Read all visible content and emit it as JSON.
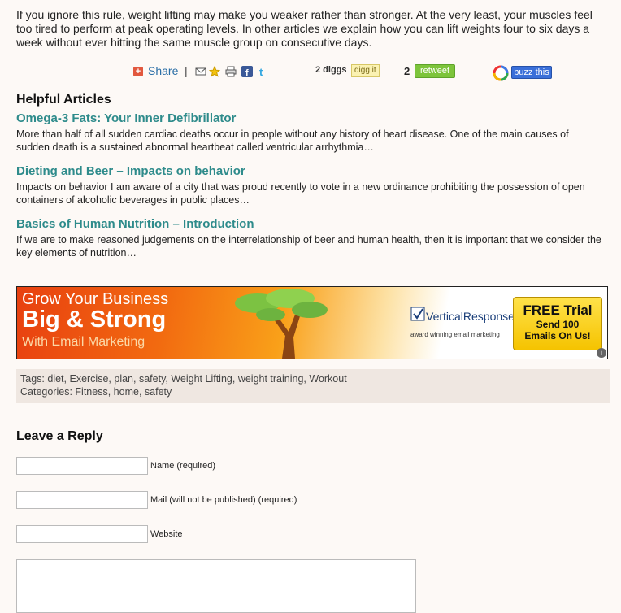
{
  "intro_text": "If you ignore this rule, weight lifting may make you weaker rather than stronger. At the very least, your muscles feel too tired to perform at peak operating levels. In other articles we explain how you can lift weights four to six days a week without ever hitting the same muscle group on consecutive days.",
  "share": {
    "share_label": "Share",
    "separator": "|",
    "icons": [
      "plus-icon",
      "mail-icon",
      "star-icon",
      "print-icon",
      "facebook-icon",
      "twitter-icon"
    ],
    "diggs_count": "2 diggs",
    "digg_button": "digg it",
    "retweet_count": "2",
    "retweet_button": "retweet",
    "buzz_button": "buzz this"
  },
  "helpful": {
    "heading": "Helpful Articles",
    "articles": [
      {
        "title": "Omega-3 Fats: Your Inner Defibrillator",
        "excerpt": "More than half of all sudden cardiac deaths occur in people without any history of heart disease. One of the main causes of sudden death is a sustained abnormal heartbeat called ventricular arrhythmia…"
      },
      {
        "title": "Dieting and Beer – Impacts on behavior",
        "excerpt": "Impacts on behavior I am aware of  a city that was proud recently to vote in a new ordinance prohibiting the possession of open containers of alcoholic beverages in public places…"
      },
      {
        "title": "Basics of Human Nutrition – Introduction",
        "excerpt": "If we are to make reasoned judgements on the interrelationship of beer and human health, then it is important that we consider the key elements of nutrition…"
      }
    ]
  },
  "banner": {
    "line1": "Grow Your Business",
    "line2": "Big & Strong",
    "line3": "With Email Marketing",
    "logo": "VerticalResponse",
    "logo_sub": "award winning email marketing",
    "trial_title": "FREE Trial",
    "trial_line1": "Send 100",
    "trial_line2": "Emails On Us!",
    "colors": {
      "orange": "#f26a10",
      "yellow": "#f5c300",
      "blue": "#1b3f7a"
    }
  },
  "meta": {
    "tags_label": "Tags:",
    "tags": [
      "diet",
      "Exercise",
      "plan",
      "safety",
      "Weight Lifting",
      "weight training",
      "Workout"
    ],
    "categories_label": "Categories:",
    "categories": [
      "Fitness",
      "home",
      "safety"
    ]
  },
  "reply": {
    "heading": "Leave a Reply",
    "name_label": "Name (required)",
    "mail_label": "Mail (will not be published) (required)",
    "website_label": "Website",
    "name_value": "",
    "mail_value": "",
    "website_value": ""
  },
  "colors": {
    "background": "#fdf9f6",
    "link_teal": "#2e8b8b",
    "share_blue": "#2a6ea6",
    "tags_bg": "#efe7e1",
    "retweet_green": "#7dc43b",
    "buzz_blue": "#3a6fd9"
  }
}
